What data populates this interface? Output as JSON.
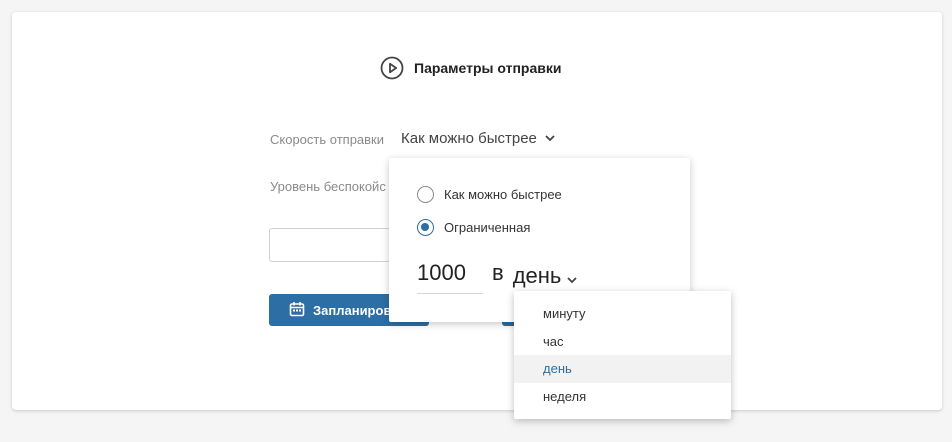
{
  "header": {
    "title": "Параметры отправки",
    "icon": "play-circle-icon"
  },
  "form": {
    "speed_label": "Скорость отправки",
    "speed_value": "Как можно быстрее",
    "level_label": "Уровень беспокойс",
    "schedule_button": "Запланиров"
  },
  "speed_popover": {
    "options": [
      {
        "label": "Как можно быстрее",
        "checked": false
      },
      {
        "label": "Ограниченная",
        "checked": true
      }
    ],
    "limit_value": "1000",
    "separator": "в",
    "unit_value": "день"
  },
  "unit_dropdown": {
    "items": [
      "минуту",
      "час",
      "день",
      "неделя"
    ],
    "selected": "день"
  },
  "colors": {
    "accent": "#2d6ea5",
    "background": "#f5f5f5",
    "card": "#ffffff"
  }
}
